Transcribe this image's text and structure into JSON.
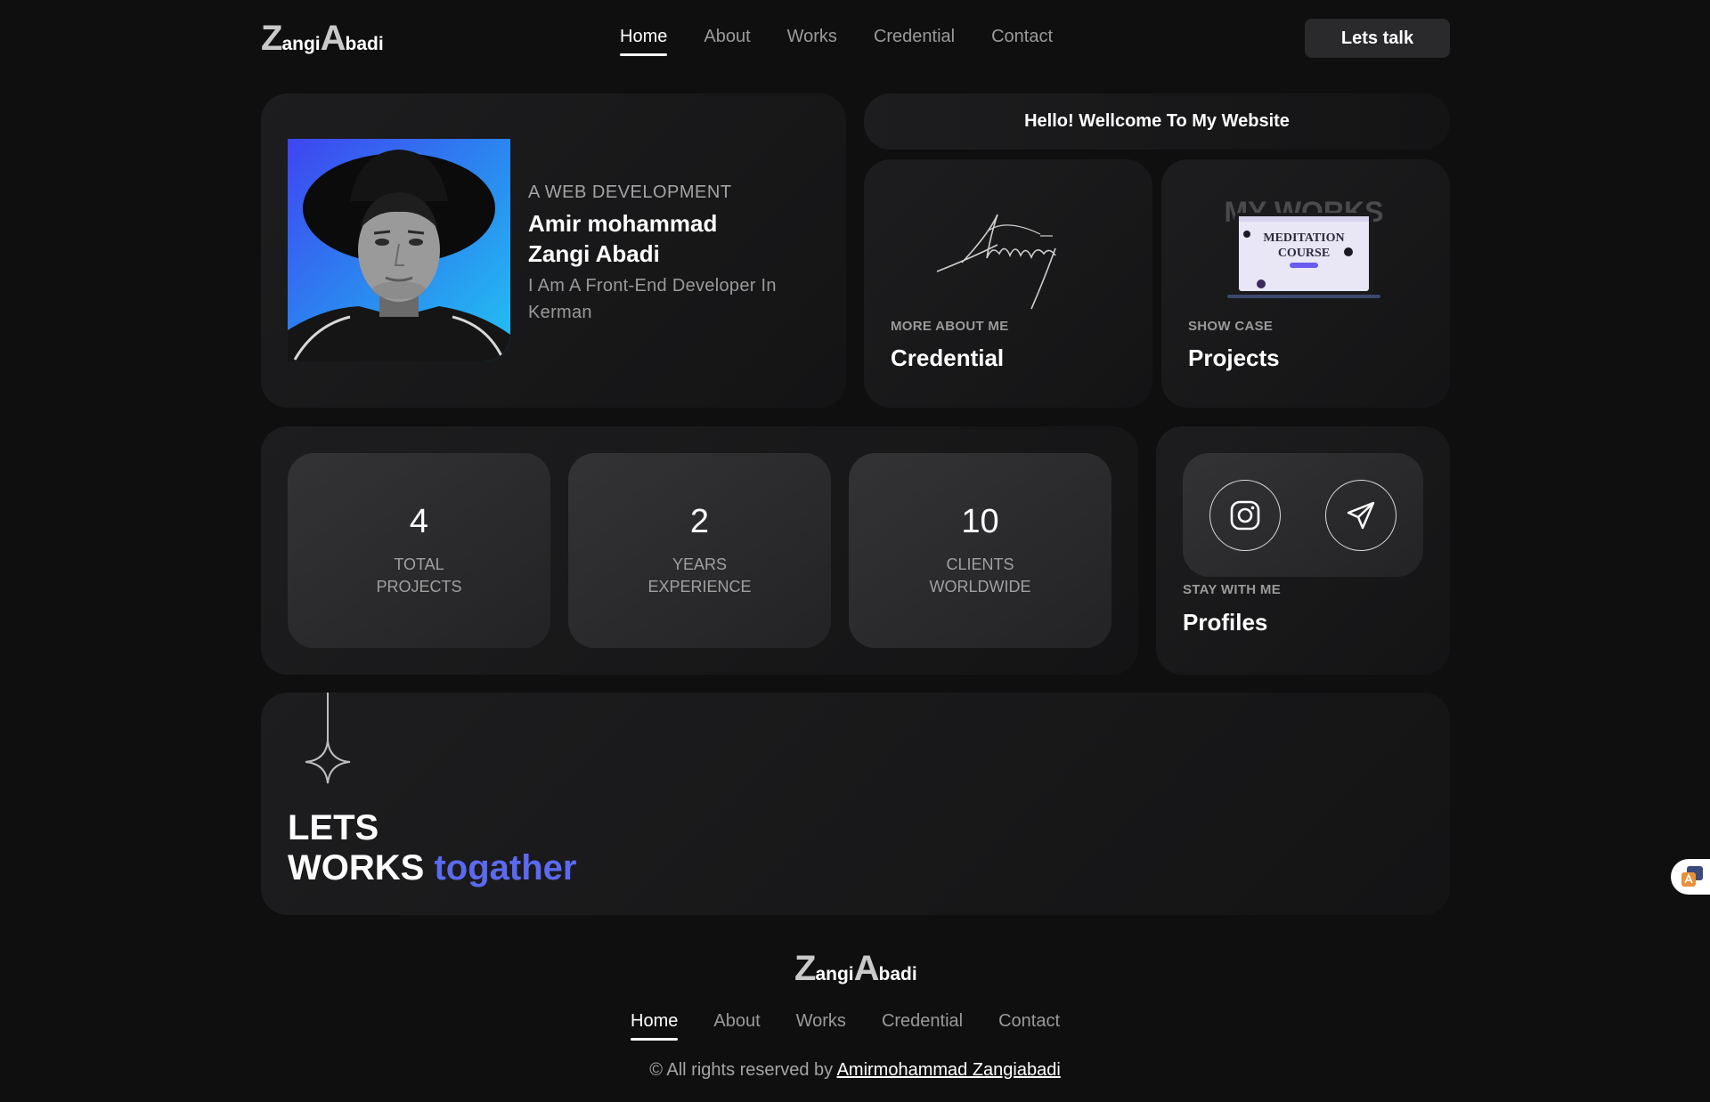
{
  "header": {
    "logo": {
      "z": "Z",
      "angi": "angi",
      "a": "A",
      "badi": "badi"
    },
    "nav": [
      "Home",
      "About",
      "Works",
      "Credential",
      "Contact"
    ],
    "active_nav": "Home",
    "cta_button": "Lets talk"
  },
  "profile": {
    "role": "A WEB DEVELOPMENT",
    "name_line1": "Amir mohammad",
    "name_line2": "Zangi Abadi",
    "description": "I Am A Front-End Developer In Kerman"
  },
  "welcome": "Hello! Wellcome To My Website",
  "credential_card": {
    "subtitle": "MORE ABOUT ME",
    "title": "Credential"
  },
  "projects_card": {
    "subtitle": "SHOW CASE",
    "title": "Projects",
    "thumbnail_heading": "MY WORKS",
    "thumbnail_text_1": "MEDITATION",
    "thumbnail_text_2": "COURSE"
  },
  "stats": [
    {
      "number": "4",
      "label_1": "TOTAL",
      "label_2": "PROJECTS"
    },
    {
      "number": "2",
      "label_1": "YEARS",
      "label_2": "EXPERIENCE"
    },
    {
      "number": "10",
      "label_1": "CLIENTS",
      "label_2": "WORLDWIDE"
    }
  ],
  "profiles_card": {
    "subtitle": "STAY WITH ME",
    "title": "Profiles",
    "icons": [
      "instagram-icon",
      "telegram-icon"
    ]
  },
  "cta": {
    "line1": "LETS",
    "line2": "WORKS",
    "accent": "togather",
    "accent_color": "#5b6af0"
  },
  "footer": {
    "nav": [
      "Home",
      "About",
      "Works",
      "Credential",
      "Contact"
    ],
    "copyright_prefix": "© All rights reserved by",
    "copyright_link": "Amirmohammad Zangiabadi"
  }
}
